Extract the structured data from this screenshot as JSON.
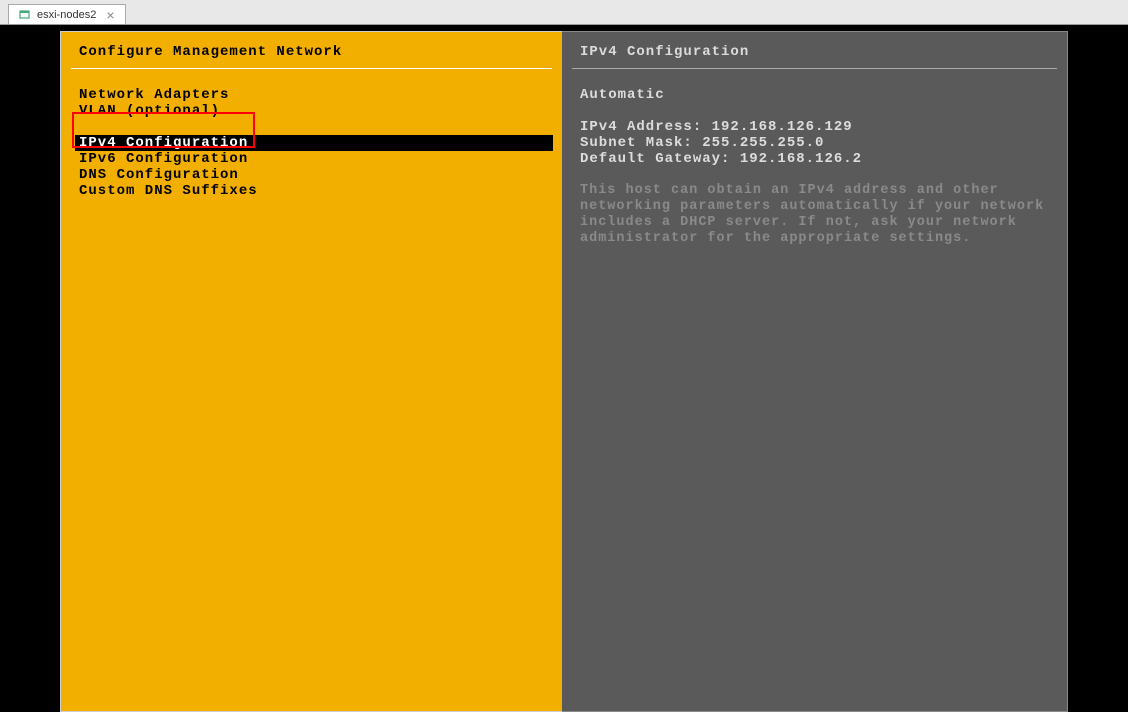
{
  "tab": {
    "title": "esxi-nodes2"
  },
  "left_panel": {
    "title": "Configure Management Network",
    "menu": [
      {
        "label": "Network Adapters",
        "selected": false
      },
      {
        "label": "VLAN (optional)",
        "selected": false
      },
      {
        "label": "IPv4 Configuration",
        "selected": true
      },
      {
        "label": "IPv6 Configuration",
        "selected": false
      },
      {
        "label": "DNS Configuration",
        "selected": false
      },
      {
        "label": "Custom DNS Suffixes",
        "selected": false
      }
    ]
  },
  "right_panel": {
    "title": "IPv4 Configuration",
    "mode": "Automatic",
    "ipv4_address_label": "IPv4 Address:",
    "ipv4_address_value": "192.168.126.129",
    "subnet_mask_label": "Subnet Mask:",
    "subnet_mask_value": "255.255.255.0",
    "default_gateway_label": "Default Gateway:",
    "default_gateway_value": "192.168.126.2",
    "help_text": "This host can obtain an IPv4 address and other networking parameters automatically if your network includes a DHCP server. If not, ask your network administrator for the appropriate settings."
  }
}
